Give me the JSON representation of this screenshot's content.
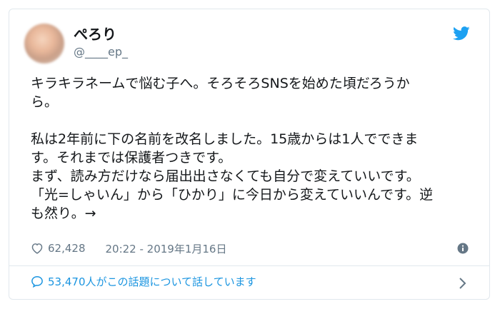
{
  "user": {
    "name": "ぺろり",
    "handle": "@____ep_"
  },
  "tweet": {
    "lines": [
      "キラキラネームで悩む子へ。そろそろSNSを始めた頃だろうか",
      "ら。",
      "",
      "私は2年前に下の名前を改名しました。15歳からは1人でできま",
      "す。それまでは保護者つきです。",
      "まず、読み方だけなら届出出さなくても自分で変えていいです。",
      "「光=しゃいん」から「ひかり」に今日から変えていいんです。逆",
      "も然り。→"
    ]
  },
  "meta": {
    "likes": "62,428",
    "timestamp": "20:22 - 2019年1月16日"
  },
  "footer": {
    "talking": "53,470人がこの話題について話しています"
  },
  "icons": {
    "bird": "twitter-bird-icon",
    "heart": "heart-icon",
    "info": "info-icon",
    "bubble": "speech-bubble-icon",
    "chevron": "chevron-right-icon"
  },
  "colors": {
    "brand": "#1da1f2",
    "link": "#1b95e0",
    "muted": "#657786",
    "text": "#14171a",
    "border": "#e1e8ed"
  }
}
